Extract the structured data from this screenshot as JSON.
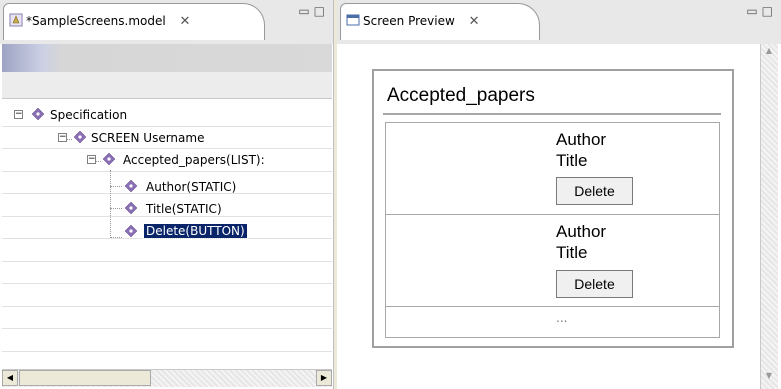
{
  "left_view": {
    "tab_title": "*SampleScreens.model",
    "close_glyph": "✕",
    "min_glyph": "▭",
    "max_glyph": "□",
    "tree": [
      {
        "label": "Specification",
        "expander": "−"
      },
      {
        "label": "SCREEN Username",
        "expander": "−"
      },
      {
        "label": "Accepted_papers(LIST):",
        "expander": "−"
      },
      {
        "label": "Author(STATIC)"
      },
      {
        "label": "Title(STATIC)"
      },
      {
        "label": "Delete(BUTTON)",
        "selected": true
      }
    ],
    "scroll_left_glyph": "◀",
    "scroll_right_glyph": "▶"
  },
  "right_view": {
    "tab_title": "Screen Preview",
    "close_glyph": "✕",
    "min_glyph": "▭",
    "max_glyph": "□",
    "scroll_up_glyph": "▲",
    "scroll_down_glyph": "▼",
    "preview": {
      "screen_title": "Accepted_papers",
      "items": [
        {
          "author": "Author",
          "title": "Title",
          "button": "Delete"
        },
        {
          "author": "Author",
          "title": "Title",
          "button": "Delete"
        }
      ],
      "more": "..."
    }
  },
  "colors": {
    "selection": "#0a246a",
    "diamond": "#8a6fb5",
    "border": "#a8a8a8"
  },
  "icons": {
    "model_file": "model-file-icon",
    "tree_node": "diamond-node-icon",
    "preview_view": "window-icon"
  }
}
